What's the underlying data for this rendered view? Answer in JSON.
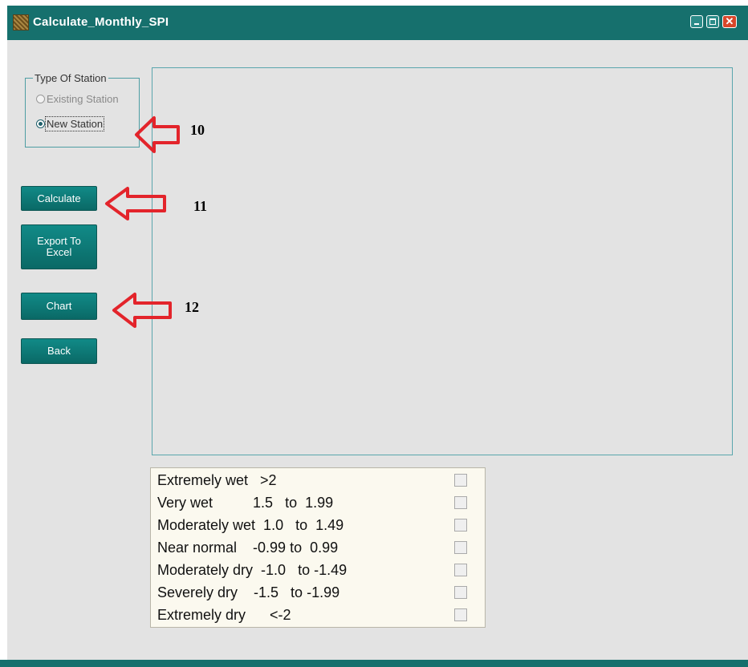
{
  "window": {
    "title": "Calculate_Monthly_SPI"
  },
  "station_group": {
    "legend": "Type Of Station",
    "options": [
      {
        "label": "Existing Station",
        "enabled": false,
        "selected": false
      },
      {
        "label": "New Station",
        "enabled": true,
        "selected": true
      }
    ]
  },
  "buttons": {
    "calculate": "Calculate",
    "export_line1": "Export To",
    "export_line2": "Excel",
    "chart": "Chart",
    "back": "Back"
  },
  "spi_legend": [
    {
      "label": "Extremely wet   >2",
      "checked": false
    },
    {
      "label": "Very wet          1.5   to  1.99",
      "checked": false
    },
    {
      "label": "Moderately wet  1.0   to  1.49",
      "checked": false
    },
    {
      "label": "Near normal    -0.99 to  0.99",
      "checked": false
    },
    {
      "label": "Moderately dry  -1.0   to -1.49",
      "checked": false
    },
    {
      "label": "Severely dry    -1.5   to -1.99",
      "checked": false
    },
    {
      "label": "Extremely dry      <-2",
      "checked": false
    }
  ],
  "annotations": [
    {
      "number": "10",
      "points_to": "New Station"
    },
    {
      "number": "11",
      "points_to": "Calculate"
    },
    {
      "number": "12",
      "points_to": "Chart"
    }
  ],
  "colors": {
    "titlebar": "#16706d",
    "button": "#118a87",
    "arrow": "#e3242b",
    "background": "#e3e3e3"
  }
}
